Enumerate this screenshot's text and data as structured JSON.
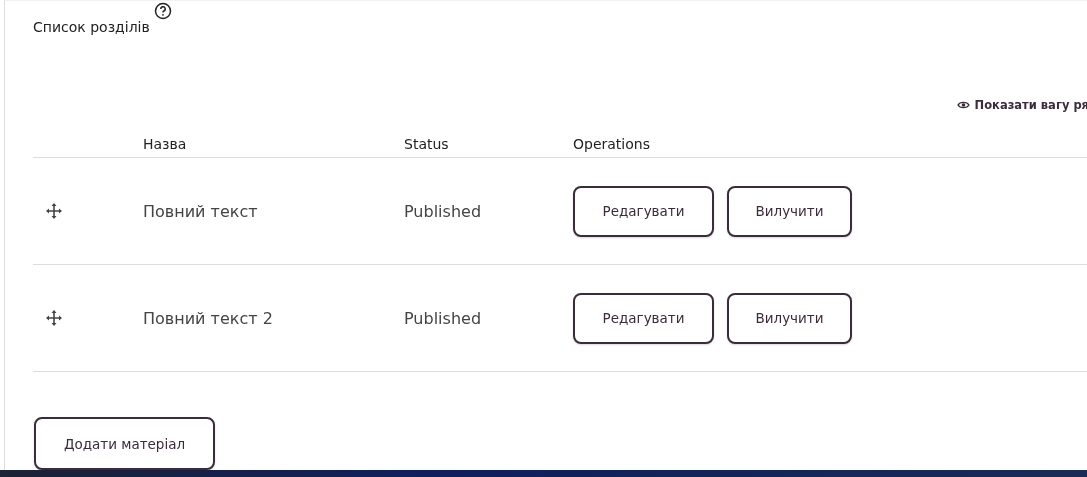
{
  "section": {
    "title": "Список розділів",
    "toggle_weights": "Показати вагу ря"
  },
  "table": {
    "columns": [
      "Назва",
      "Status",
      "Operations"
    ],
    "rows": [
      {
        "name": "Повний текст",
        "status": "Published",
        "actions": [
          "Редагувати",
          "Вилучити"
        ]
      },
      {
        "name": "Повний текст 2",
        "status": "Published",
        "actions": [
          "Редагувати",
          "Вилучити"
        ]
      }
    ]
  },
  "add_button": "Додати матеріал"
}
